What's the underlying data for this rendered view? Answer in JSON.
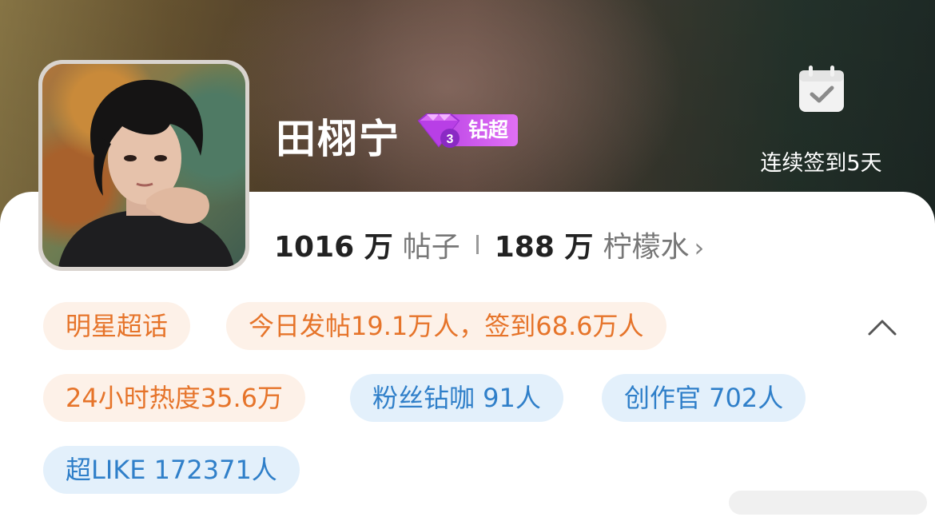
{
  "profile": {
    "name": "田栩宁",
    "badge_label": "钻超",
    "badge_level": "3"
  },
  "checkin": {
    "label": "连续签到5天",
    "icon": "calendar-check-icon"
  },
  "stats": {
    "posts_count": "1016 万",
    "posts_label": "帖子",
    "fans_count": "188 万",
    "fans_label": "柠檬水"
  },
  "tags": [
    {
      "text": "明星超话",
      "style": "orange"
    },
    {
      "text": "今日发帖19.1万人，签到68.6万人",
      "style": "orange"
    },
    {
      "text": "24小时热度35.6万",
      "style": "orange"
    },
    {
      "text": "粉丝钻咖 91人",
      "style": "blue"
    },
    {
      "text": "创作官 702人",
      "style": "blue"
    },
    {
      "text": "超LIKE 172371人",
      "style": "blue"
    }
  ],
  "colors": {
    "tag_orange_bg": "#fdf1e8",
    "tag_orange_text": "#e6742a",
    "tag_blue_bg": "#e3f0fb",
    "tag_blue_text": "#2f7fc9",
    "badge_purple": "#c04be8"
  }
}
